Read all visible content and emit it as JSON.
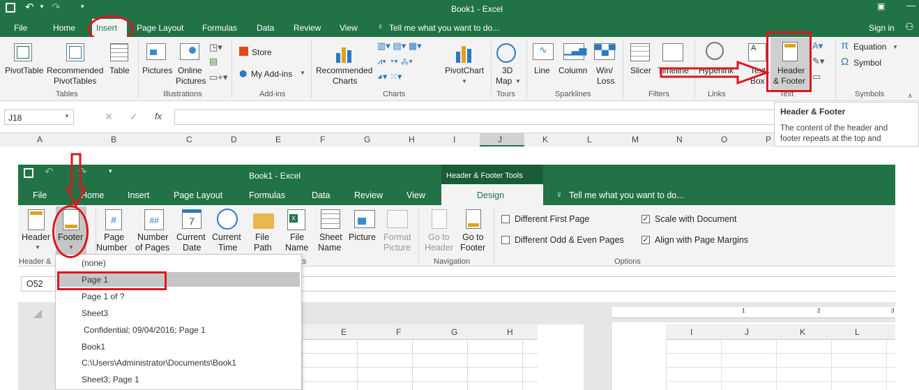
{
  "window1": {
    "title": "Book1 - Excel",
    "tabs": [
      "File",
      "Home",
      "Insert",
      "Page Layout",
      "Formulas",
      "Data",
      "Review",
      "View"
    ],
    "tell_me": "Tell me what you want to do...",
    "sign_in": "Sign in",
    "buttons": {
      "pivottable": "PivotTable",
      "recommended_pivottables": [
        "Recommended",
        "PivotTables"
      ],
      "table": "Table",
      "pictures": "Pictures",
      "online_pictures": [
        "Online",
        "Pictures"
      ],
      "store": "Store",
      "my_addins": "My Add-ins",
      "recommended_charts": [
        "Recommended",
        "Charts"
      ],
      "pivotchart": "PivotChart",
      "map3d": [
        "3D",
        "Map"
      ],
      "line": "Line",
      "column": "Column",
      "winloss": [
        "Win/",
        "Loss"
      ],
      "slicer": "Slicer",
      "timeline": "Timeline",
      "hyperlink": "Hyperlink",
      "textbox": [
        "Text",
        "Box"
      ],
      "header_footer": [
        "Header",
        "& Footer"
      ],
      "equation": "Equation",
      "symbol": "Symbol"
    },
    "groups": [
      "Tables",
      "Illustrations",
      "Add-ins",
      "Charts",
      "Tours",
      "Sparklines",
      "Filters",
      "Links",
      "Text",
      "Symbols"
    ],
    "namebox": "J18",
    "fx": "fx",
    "columns": [
      "A",
      "B",
      "C",
      "D",
      "E",
      "F",
      "G",
      "H",
      "I",
      "J",
      "K",
      "L",
      "M",
      "N",
      "O",
      "P"
    ],
    "tooltip": {
      "title": "Header & Footer",
      "body": [
        "The content of the header and",
        "footer repeats at the top and"
      ]
    }
  },
  "window2": {
    "title": "Book1 - Excel",
    "tools_title": "Header & Footer Tools",
    "tabs": [
      "File",
      "Home",
      "Insert",
      "Page Layout",
      "Formulas",
      "Data",
      "Review",
      "View"
    ],
    "design_tab": "Design",
    "tell_me": "Tell me what you want to do...",
    "buttons": {
      "header": "Header",
      "footer": "Footer",
      "page_number": [
        "Page",
        "Number"
      ],
      "number_of_pages": [
        "Number",
        "of Pages"
      ],
      "current_date": [
        "Current",
        "Date"
      ],
      "current_time": [
        "Current",
        "Time"
      ],
      "file_path": [
        "File",
        "Path"
      ],
      "file_name": [
        "File",
        "Name"
      ],
      "sheet_name": [
        "Sheet",
        "Name"
      ],
      "picture": "Picture",
      "format_picture": [
        "Format",
        "Picture"
      ],
      "go_to_header": [
        "Go to",
        "Header"
      ],
      "go_to_footer": [
        "Go to",
        "Footer"
      ]
    },
    "options": {
      "different_first_page": "Different First Page",
      "different_odd_even": "Different Odd & Even Pages",
      "scale_with_document": "Scale with Document",
      "align_with_margins": "Align with Page Margins"
    },
    "groups": [
      "Header &",
      "ts",
      "Navigation",
      "Options"
    ],
    "namebox": "O52",
    "footer_menu": [
      "(none)",
      "Page 1",
      "Page 1 of ?",
      "Sheet3",
      "Confidential; 09/04/2016; Page 1",
      "Book1",
      "C:\\Users\\Administrator\\Documents\\Book1",
      "Sheet3; Page 1"
    ],
    "columns": [
      "E",
      "F",
      "G",
      "H",
      "I",
      "J",
      "K",
      "L"
    ],
    "ruler": [
      "1",
      "2",
      "3"
    ]
  },
  "colors": {
    "excel_green": "#217346",
    "highlight_red": "#e0141c",
    "ribbon_bg": "#f3f3f3"
  }
}
